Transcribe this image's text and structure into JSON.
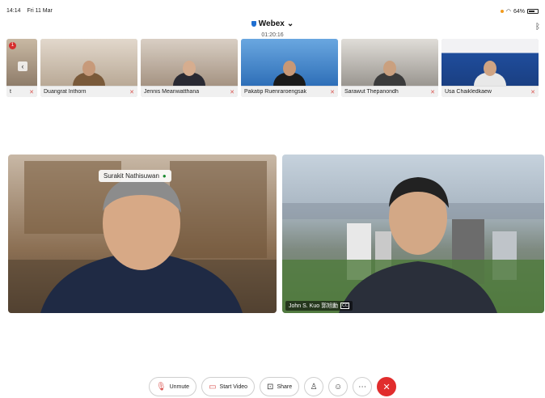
{
  "status_bar": {
    "time": "14:14",
    "date": "Fri 11 Mar",
    "battery": "64%"
  },
  "header": {
    "app_title": "Webex",
    "duration": "01:20:16"
  },
  "participants_strip": {
    "badge_count": "1",
    "participants": [
      {
        "name": "t"
      },
      {
        "name": "Duangrat Inthorn"
      },
      {
        "name": "Jennis Meanwatthana"
      },
      {
        "name": "Pakatip Ruenraroengsak"
      },
      {
        "name": "Sarawut Thepanondh"
      },
      {
        "name": "Usa Chaikledkaew"
      }
    ]
  },
  "main_stage": {
    "active_speaker_label": "Surakit Nathisuwan",
    "right_tile_name": "John S. Kuo 郭旭勳"
  },
  "controls": {
    "unmute_label": "Unmute",
    "start_video_label": "Start Video",
    "share_label": "Share"
  },
  "colors": {
    "leave": "#e12d2d",
    "mic_muted": "#d9534f",
    "accent": "#1f6fd1"
  }
}
